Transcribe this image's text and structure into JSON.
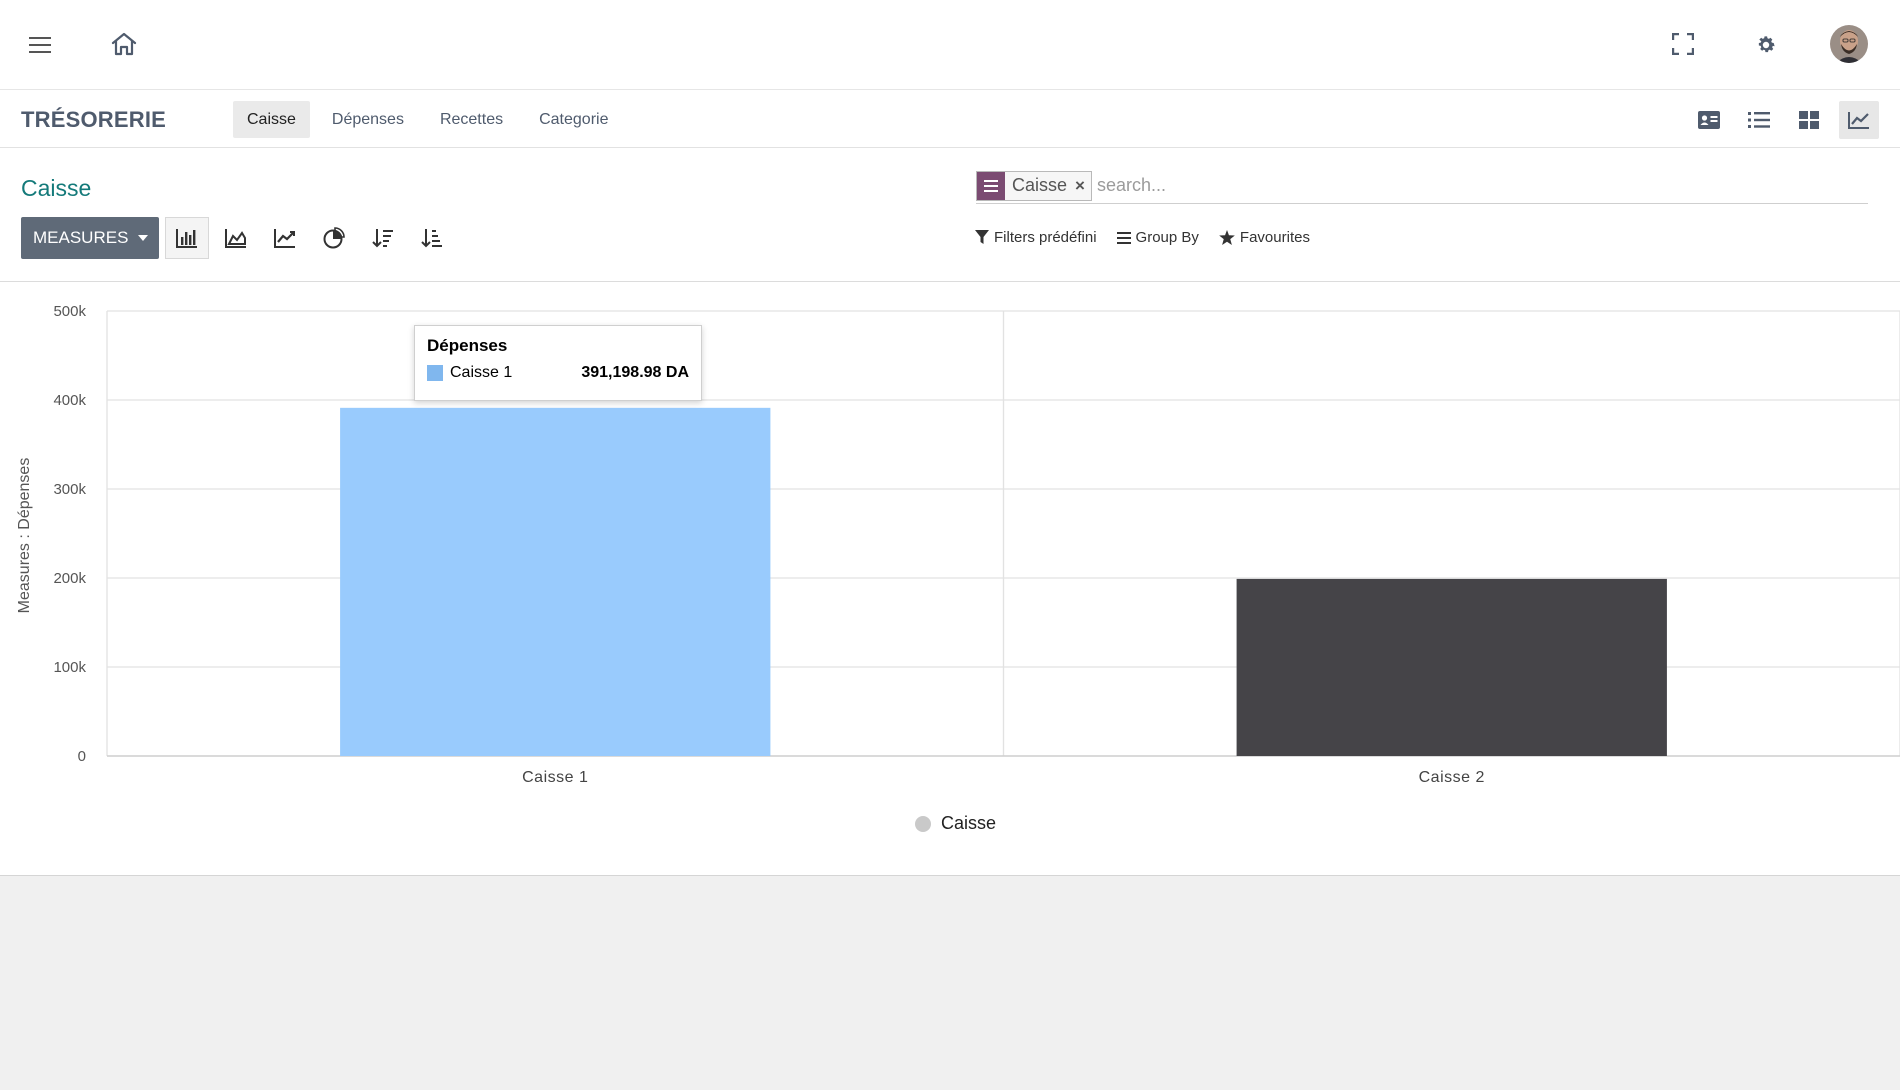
{
  "header": {
    "menu_icon": "hamburger-menu-icon",
    "home_icon": "home-icon",
    "fullscreen_icon": "fullscreen-icon",
    "settings_icon": "gear-icon",
    "avatar_icon": "user-avatar"
  },
  "module": {
    "title": "TRÉSORERIE",
    "tabs": [
      {
        "label": "Caisse",
        "active": true
      },
      {
        "label": "Dépenses",
        "active": false
      },
      {
        "label": "Recettes",
        "active": false
      },
      {
        "label": "Categorie",
        "active": false
      }
    ],
    "views": [
      {
        "icon": "kanban-card-icon",
        "active": false
      },
      {
        "icon": "list-icon",
        "active": false
      },
      {
        "icon": "grid-icon",
        "active": false
      },
      {
        "icon": "graph-icon",
        "active": true
      }
    ]
  },
  "control": {
    "page_title": "Caisse",
    "measures_label": "MEASURES",
    "chart_tools": [
      {
        "icon": "bar-chart-icon",
        "active": true
      },
      {
        "icon": "area-chart-icon",
        "active": false
      },
      {
        "icon": "line-chart-icon",
        "active": false
      },
      {
        "icon": "pie-chart-icon",
        "active": false
      },
      {
        "icon": "sort-descending-icon",
        "active": false
      },
      {
        "icon": "sort-ascending-icon",
        "active": false
      }
    ],
    "search": {
      "facet_label": "Caisse",
      "facet_remove": "×",
      "placeholder": "search...",
      "value": ""
    },
    "filters_label": "Filters prédéfini",
    "groupby_label": "Group By",
    "favourites_label": "Favourites"
  },
  "colors": {
    "bar_1": "#99cbfd",
    "bar_2": "#454448",
    "tooltip_swatch": "#80b7ee",
    "legend_dot": "#c9c9c9",
    "facet_bg": "#7b4b72",
    "accent_title": "#147a7a"
  },
  "chart_data": {
    "type": "bar",
    "ylabel": "Measures : Dépenses",
    "ylim": [
      0,
      500000
    ],
    "yticks": [
      0,
      100000,
      200000,
      300000,
      400000,
      500000
    ],
    "ytick_labels": [
      "0",
      "100k",
      "200k",
      "300k",
      "400k",
      "500k"
    ],
    "categories": [
      "Caisse 1",
      "Caisse 2"
    ],
    "values": [
      391198.98,
      199000
    ],
    "legend": "Caisse",
    "grid": true,
    "tooltip": {
      "title": "Dépenses",
      "label": "Caisse 1",
      "value": "391,198.98 DA"
    }
  }
}
